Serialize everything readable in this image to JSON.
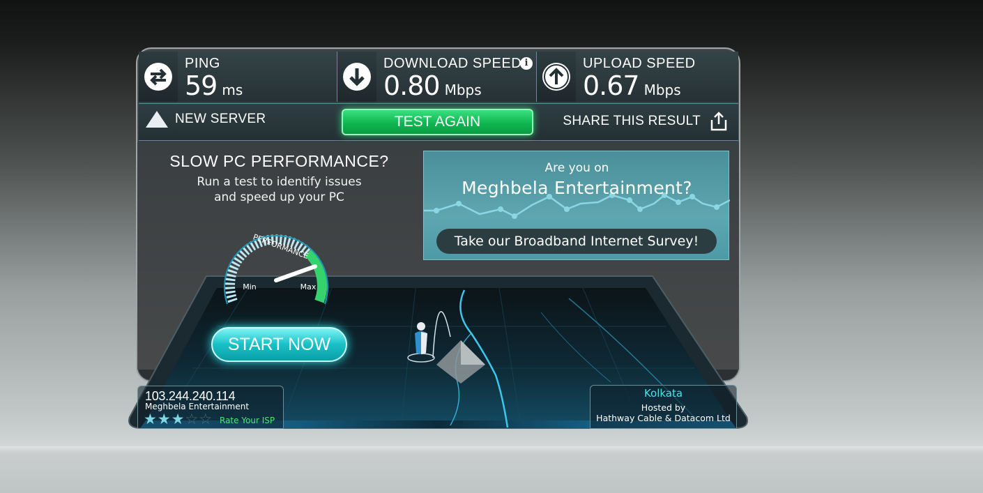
{
  "results": {
    "ping": {
      "label": "PING",
      "value": "59",
      "unit": "ms",
      "icon": "ping-arrows-icon"
    },
    "download": {
      "label": "DOWNLOAD SPEED",
      "value": "0.80",
      "unit": "Mbps",
      "icon": "download-arrow-icon",
      "info": "i"
    },
    "upload": {
      "label": "UPLOAD SPEED",
      "value": "0.67",
      "unit": "Mbps",
      "icon": "upload-arrow-icon"
    }
  },
  "actions": {
    "new_server": "NEW SERVER",
    "test_again": "TEST AGAIN",
    "share": "SHARE THIS RESULT"
  },
  "pc_ad": {
    "title": "SLOW PC PERFORMANCE?",
    "line1": "Run a test to identify issues",
    "line2": "and speed up your PC",
    "gauge_label": "PERFORMANCE",
    "gauge_min": "Min",
    "gauge_max": "Max",
    "button": "START NOW"
  },
  "survey": {
    "question1": "Are you on",
    "question2": "Meghbela Entertainment?",
    "button": "Take our Broadband Internet Survey!"
  },
  "client": {
    "ip": "103.244.240.114",
    "isp": "Meghbela Entertainment",
    "rating": 3,
    "rating_max": 5,
    "rate_link": "Rate Your ISP"
  },
  "server": {
    "city": "Kolkata",
    "hosted_by": "Hosted by",
    "host": "Hathway Cable & Datacom Ltd"
  },
  "colors": {
    "accent_green": "#0fb652",
    "accent_cyan": "#18c1c7",
    "rate_green": "#4fe37c",
    "city_cyan": "#4de0e8"
  }
}
